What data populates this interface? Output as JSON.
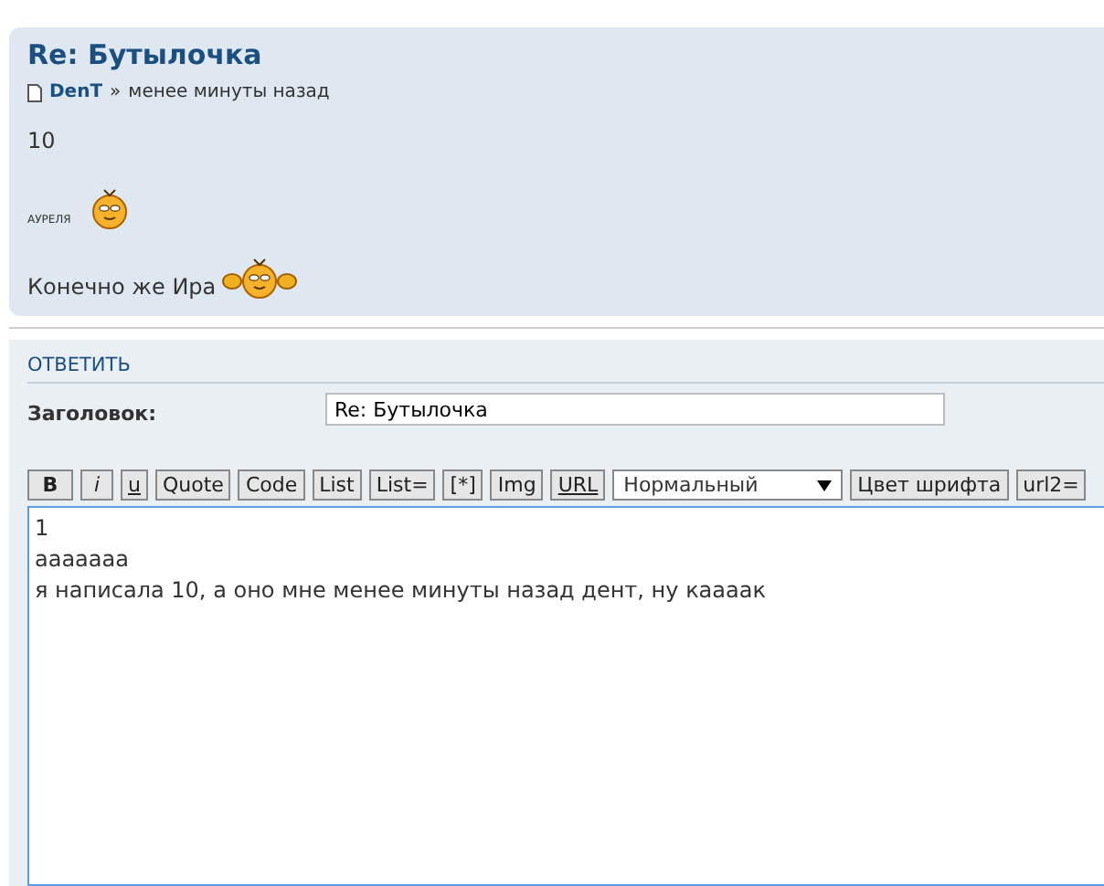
{
  "post": {
    "title": "Re: Бутылочка",
    "author": "DenT",
    "separator": "»",
    "time": "менее минуты назад",
    "body_first": "10",
    "caption": "АУРЕЛЯ",
    "body_last": "Конечно же Ира"
  },
  "reply": {
    "heading": "ОТВЕТИТЬ",
    "subject_label": "Заголовок:",
    "subject_value": "Re: Бутылочка",
    "toolbar": [
      {
        "label": "B",
        "kind": "bold"
      },
      {
        "label": "i",
        "kind": "italic"
      },
      {
        "label": "u",
        "kind": "underline"
      },
      {
        "label": "Quote",
        "kind": "plain"
      },
      {
        "label": "Code",
        "kind": "plain"
      },
      {
        "label": "List",
        "kind": "plain"
      },
      {
        "label": "List=",
        "kind": "plain"
      },
      {
        "label": "[*]",
        "kind": "plain"
      },
      {
        "label": "Img",
        "kind": "plain"
      },
      {
        "label": "URL",
        "kind": "underline"
      },
      {
        "label": "Нормальный",
        "kind": "select"
      },
      {
        "label": "Цвет шрифта",
        "kind": "plain"
      },
      {
        "label": "url2=",
        "kind": "plain"
      }
    ],
    "message": [
      "1",
      "ааааааа",
      "я написала 10, а оно мне менее минуты назад дент, ну каааак"
    ]
  }
}
